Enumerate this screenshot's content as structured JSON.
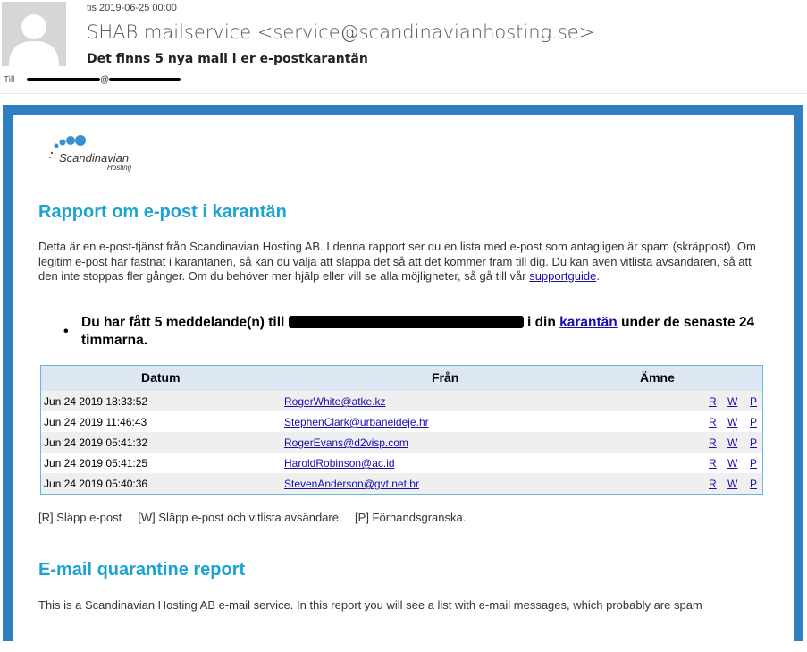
{
  "header": {
    "date": "tis 2019-06-25 00:00",
    "sender": "SHAB mailservice <service@scandinavianhosting.se>",
    "subject": "Det finns 5 nya mail i er e-postkarantän",
    "to_label": "Till",
    "to_address_visible": "@"
  },
  "logo": {
    "line1": "Scandinavian",
    "line2": "Hosting"
  },
  "report_sv": {
    "title": "Rapport om e-post i karantän",
    "intro": "Detta är en e-post-tjänst från Scandinavian Hosting AB. I denna rapport ser du en lista med e-post som antagligen är spam (skräppost). Om legitim e-post har fastnat i karantänen, så kan du välja att släppa det så att det kommer fram till dig. Du kan även vitlista avsändaren, så att den inte stoppas fler gånger. Om du behöver mer hjälp eller vill se alla möjligheter, så gå till vår",
    "support_link": "supportguide",
    "intro_end": ".",
    "notice_pre": "Du har fått 5 meddelande(n) till ",
    "notice_mid": " i din ",
    "notice_link": "karantän",
    "notice_post": " under de senaste 24 timmarna."
  },
  "table": {
    "headers": {
      "date": "Datum",
      "from": "Från",
      "subject": "Ämne"
    },
    "actions": {
      "release": "R",
      "whitelist": "W",
      "preview": "P"
    },
    "rows": [
      {
        "date": "Jun 24 2019 18:33:52",
        "from": "RogerWhite@atke.kz"
      },
      {
        "date": "Jun 24 2019 11:46:43",
        "from": "StephenClark@urbaneideje.hr"
      },
      {
        "date": "Jun 24 2019 05:41:32",
        "from": "RogerEvans@d2visp.com"
      },
      {
        "date": "Jun 24 2019 05:41:25",
        "from": "HaroldRobinson@ac.id"
      },
      {
        "date": "Jun 24 2019 05:40:36",
        "from": "StevenAnderson@gvt.net.br"
      }
    ]
  },
  "legend": "[R] Släpp e-post     [W] Släpp e-post och vitlista avsändare     [P] Förhandsgranska.",
  "report_en": {
    "title": "E-mail quarantine report",
    "intro": "This is a Scandinavian Hosting AB e-mail service. In this report you will see a list with e-mail messages, which probably are spam"
  },
  "colors": {
    "frame": "#2f7fc1",
    "heading": "#1aa3d3",
    "link": "#1a0dab",
    "table_header": "#dde7f3"
  }
}
